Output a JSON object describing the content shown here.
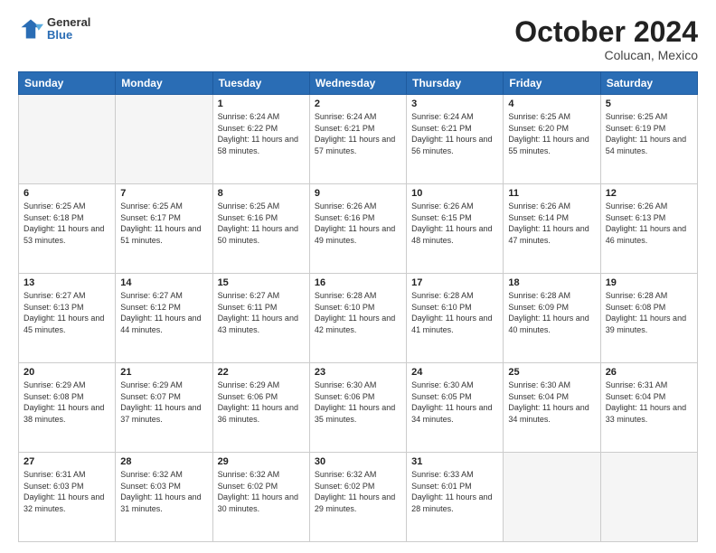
{
  "header": {
    "logo": {
      "general": "General",
      "blue": "Blue"
    },
    "title": "October 2024",
    "location": "Colucan, Mexico"
  },
  "days_of_week": [
    "Sunday",
    "Monday",
    "Tuesday",
    "Wednesday",
    "Thursday",
    "Friday",
    "Saturday"
  ],
  "weeks": [
    [
      {
        "day": "",
        "info": ""
      },
      {
        "day": "",
        "info": ""
      },
      {
        "day": "1",
        "info": "Sunrise: 6:24 AM\nSunset: 6:22 PM\nDaylight: 11 hours and 58 minutes."
      },
      {
        "day": "2",
        "info": "Sunrise: 6:24 AM\nSunset: 6:21 PM\nDaylight: 11 hours and 57 minutes."
      },
      {
        "day": "3",
        "info": "Sunrise: 6:24 AM\nSunset: 6:21 PM\nDaylight: 11 hours and 56 minutes."
      },
      {
        "day": "4",
        "info": "Sunrise: 6:25 AM\nSunset: 6:20 PM\nDaylight: 11 hours and 55 minutes."
      },
      {
        "day": "5",
        "info": "Sunrise: 6:25 AM\nSunset: 6:19 PM\nDaylight: 11 hours and 54 minutes."
      }
    ],
    [
      {
        "day": "6",
        "info": "Sunrise: 6:25 AM\nSunset: 6:18 PM\nDaylight: 11 hours and 53 minutes."
      },
      {
        "day": "7",
        "info": "Sunrise: 6:25 AM\nSunset: 6:17 PM\nDaylight: 11 hours and 51 minutes."
      },
      {
        "day": "8",
        "info": "Sunrise: 6:25 AM\nSunset: 6:16 PM\nDaylight: 11 hours and 50 minutes."
      },
      {
        "day": "9",
        "info": "Sunrise: 6:26 AM\nSunset: 6:16 PM\nDaylight: 11 hours and 49 minutes."
      },
      {
        "day": "10",
        "info": "Sunrise: 6:26 AM\nSunset: 6:15 PM\nDaylight: 11 hours and 48 minutes."
      },
      {
        "day": "11",
        "info": "Sunrise: 6:26 AM\nSunset: 6:14 PM\nDaylight: 11 hours and 47 minutes."
      },
      {
        "day": "12",
        "info": "Sunrise: 6:26 AM\nSunset: 6:13 PM\nDaylight: 11 hours and 46 minutes."
      }
    ],
    [
      {
        "day": "13",
        "info": "Sunrise: 6:27 AM\nSunset: 6:13 PM\nDaylight: 11 hours and 45 minutes."
      },
      {
        "day": "14",
        "info": "Sunrise: 6:27 AM\nSunset: 6:12 PM\nDaylight: 11 hours and 44 minutes."
      },
      {
        "day": "15",
        "info": "Sunrise: 6:27 AM\nSunset: 6:11 PM\nDaylight: 11 hours and 43 minutes."
      },
      {
        "day": "16",
        "info": "Sunrise: 6:28 AM\nSunset: 6:10 PM\nDaylight: 11 hours and 42 minutes."
      },
      {
        "day": "17",
        "info": "Sunrise: 6:28 AM\nSunset: 6:10 PM\nDaylight: 11 hours and 41 minutes."
      },
      {
        "day": "18",
        "info": "Sunrise: 6:28 AM\nSunset: 6:09 PM\nDaylight: 11 hours and 40 minutes."
      },
      {
        "day": "19",
        "info": "Sunrise: 6:28 AM\nSunset: 6:08 PM\nDaylight: 11 hours and 39 minutes."
      }
    ],
    [
      {
        "day": "20",
        "info": "Sunrise: 6:29 AM\nSunset: 6:08 PM\nDaylight: 11 hours and 38 minutes."
      },
      {
        "day": "21",
        "info": "Sunrise: 6:29 AM\nSunset: 6:07 PM\nDaylight: 11 hours and 37 minutes."
      },
      {
        "day": "22",
        "info": "Sunrise: 6:29 AM\nSunset: 6:06 PM\nDaylight: 11 hours and 36 minutes."
      },
      {
        "day": "23",
        "info": "Sunrise: 6:30 AM\nSunset: 6:06 PM\nDaylight: 11 hours and 35 minutes."
      },
      {
        "day": "24",
        "info": "Sunrise: 6:30 AM\nSunset: 6:05 PM\nDaylight: 11 hours and 34 minutes."
      },
      {
        "day": "25",
        "info": "Sunrise: 6:30 AM\nSunset: 6:04 PM\nDaylight: 11 hours and 34 minutes."
      },
      {
        "day": "26",
        "info": "Sunrise: 6:31 AM\nSunset: 6:04 PM\nDaylight: 11 hours and 33 minutes."
      }
    ],
    [
      {
        "day": "27",
        "info": "Sunrise: 6:31 AM\nSunset: 6:03 PM\nDaylight: 11 hours and 32 minutes."
      },
      {
        "day": "28",
        "info": "Sunrise: 6:32 AM\nSunset: 6:03 PM\nDaylight: 11 hours and 31 minutes."
      },
      {
        "day": "29",
        "info": "Sunrise: 6:32 AM\nSunset: 6:02 PM\nDaylight: 11 hours and 30 minutes."
      },
      {
        "day": "30",
        "info": "Sunrise: 6:32 AM\nSunset: 6:02 PM\nDaylight: 11 hours and 29 minutes."
      },
      {
        "day": "31",
        "info": "Sunrise: 6:33 AM\nSunset: 6:01 PM\nDaylight: 11 hours and 28 minutes."
      },
      {
        "day": "",
        "info": ""
      },
      {
        "day": "",
        "info": ""
      }
    ]
  ]
}
